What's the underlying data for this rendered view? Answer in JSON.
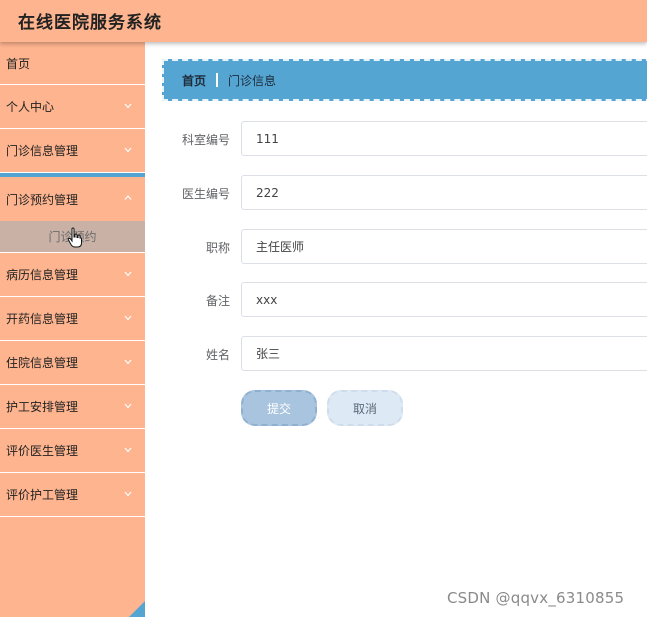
{
  "header": {
    "title": "在线医院服务系统"
  },
  "sidebar": {
    "items": [
      {
        "label": "首页"
      },
      {
        "label": "个人中心"
      },
      {
        "label": "门诊信息管理"
      },
      {
        "label": "门诊预约管理"
      },
      {
        "label": "病历信息管理"
      },
      {
        "label": "开药信息管理"
      },
      {
        "label": "住院信息管理"
      },
      {
        "label": "护工安排管理"
      },
      {
        "label": "评价医生管理"
      },
      {
        "label": "评价护工管理"
      }
    ],
    "submenu": {
      "label": "门诊预约"
    }
  },
  "breadcrumb": {
    "home": "首页",
    "current": "门诊信息"
  },
  "form": {
    "fields": [
      {
        "label": "科室编号",
        "value": "111"
      },
      {
        "label": "医生编号",
        "value": "222"
      },
      {
        "label": "职称",
        "value": "主任医师"
      },
      {
        "label": "备注",
        "value": "xxx"
      },
      {
        "label": "姓名",
        "value": "张三"
      }
    ],
    "submit_label": "提交",
    "cancel_label": "取消"
  },
  "watermark": "CSDN @qqvx_6310855",
  "colors": {
    "header_bg": "#fdb48f",
    "sidebar_bg": "#fdb48f",
    "accent": "#55a5d3",
    "submenu_bg": "#c9b1a6"
  }
}
